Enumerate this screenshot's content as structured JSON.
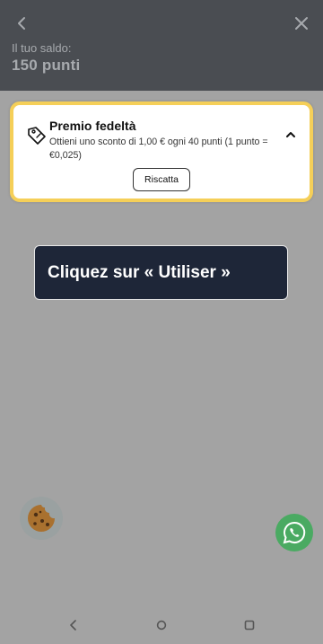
{
  "header": {
    "back_icon": "chevron-left-icon",
    "close_icon": "close-icon",
    "balance_label": "Il tuo saldo:",
    "balance_value": "150 punti"
  },
  "reward": {
    "icon": "tag-icon",
    "title": "Premio fedeltà",
    "description": "Ottieni uno sconto di 1,00 € ogni 40 punti (1 punto = €0,025)",
    "redeem_label": "Riscatta",
    "toggle_icon": "chevron-up-icon",
    "highlight_color": "#f5cf58"
  },
  "tooltip": {
    "text": "Cliquez sur « Utiliser »"
  },
  "floating": {
    "cookie_icon": "cookie-icon",
    "whatsapp_icon": "whatsapp-icon",
    "whatsapp_color": "#4aaa62"
  },
  "nav": {
    "back_icon": "nav-back-icon",
    "home_icon": "nav-home-icon",
    "recent_icon": "nav-recents-icon"
  },
  "colors": {
    "overlay": "#a3a3a3",
    "header": "#4a4d52",
    "tooltip_bg": "#1e2638"
  }
}
